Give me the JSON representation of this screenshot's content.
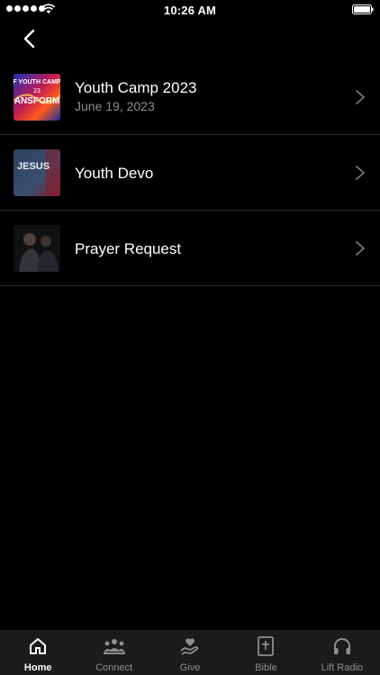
{
  "status_bar": {
    "time": "10:26 AM"
  },
  "nav": {
    "back_icon": "chevron-left-icon"
  },
  "items": [
    {
      "title": "Youth Camp 2023",
      "subtitle": "June 19, 2023",
      "thumb_text": "F YOUTH CAMP 23 ANSFORM",
      "icon": "youth-camp-thumbnail"
    },
    {
      "title": "Youth Devo",
      "subtitle": "",
      "thumb_text": "JESUS",
      "icon": "youth-devo-thumbnail"
    },
    {
      "title": "Prayer Request",
      "subtitle": "",
      "thumb_text": "",
      "icon": "prayer-thumbnail"
    }
  ],
  "tabs": [
    {
      "label": "Home",
      "icon": "home-icon",
      "active": true
    },
    {
      "label": "Connect",
      "icon": "people-icon",
      "active": false
    },
    {
      "label": "Give",
      "icon": "give-hand-heart-icon",
      "active": false
    },
    {
      "label": "Bible",
      "icon": "bible-icon",
      "active": false
    },
    {
      "label": "Lift Radio",
      "icon": "headphones-icon",
      "active": false
    }
  ],
  "colors": {
    "background": "#000000",
    "tabbar": "#1b1b1b",
    "inactive_text": "#8e8e8e",
    "subtitle": "#8d8d8d"
  }
}
